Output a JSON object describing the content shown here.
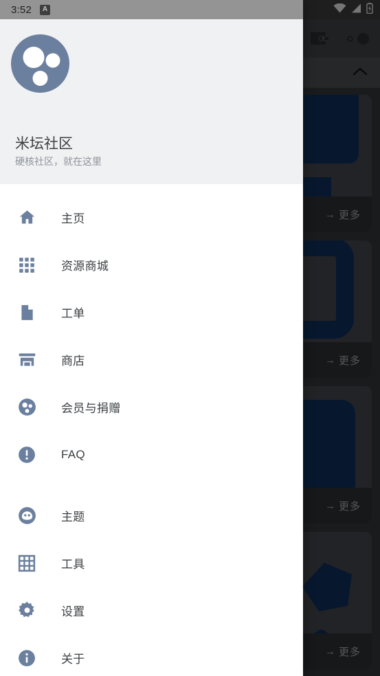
{
  "colors": {
    "icon_slate": "#6b7f9e",
    "drawer_bg": "#ffffff",
    "drawer_header_bg": "#f0f1f3",
    "statusbar_left": "#949494",
    "statusbar_right": "#373737",
    "card_art_blue": "#0d2d54",
    "text_primary": "#3c4043",
    "text_secondary": "#8e949b"
  },
  "status_bar": {
    "time": "3:52",
    "notification_badge_glyph": "A",
    "notification_badge_icon": "app-notification-icon",
    "right_icons": [
      "wifi-icon",
      "cellular-signal-icon",
      "battery-charging-icon"
    ]
  },
  "background_app": {
    "toolbar": {
      "wallet_icon": "wallet-icon",
      "theme_toggle_icon": "day-night-toggle-icon"
    },
    "section_header": {
      "collapse_icon": "chevron-up-icon"
    },
    "cards": [
      {
        "more_label": "更多",
        "more_arrow": "→"
      },
      {
        "more_label": "更多",
        "more_arrow": "→"
      },
      {
        "more_label": "更多",
        "more_arrow": "→"
      },
      {
        "more_label": "更多",
        "more_arrow": "→"
      }
    ]
  },
  "drawer": {
    "header": {
      "logo_icon": "mitan-community-logo",
      "title": "米坛社区",
      "subtitle": "硬核社区，就在这里"
    },
    "groups": [
      {
        "items": [
          {
            "label": "主页",
            "icon": "home-icon"
          },
          {
            "label": "资源商城",
            "icon": "apps-grid-icon"
          },
          {
            "label": "工单",
            "icon": "document-icon"
          },
          {
            "label": "商店",
            "icon": "storefront-icon"
          },
          {
            "label": "会员与捐赠",
            "icon": "membership-donate-icon"
          },
          {
            "label": "FAQ",
            "icon": "exclamation-circle-icon"
          }
        ]
      },
      {
        "items": [
          {
            "label": "主题",
            "icon": "theme-face-icon"
          },
          {
            "label": "工具",
            "icon": "grid-table-icon"
          },
          {
            "label": "设置",
            "icon": "gear-icon"
          },
          {
            "label": "关于",
            "icon": "info-circle-icon"
          }
        ]
      }
    ]
  }
}
